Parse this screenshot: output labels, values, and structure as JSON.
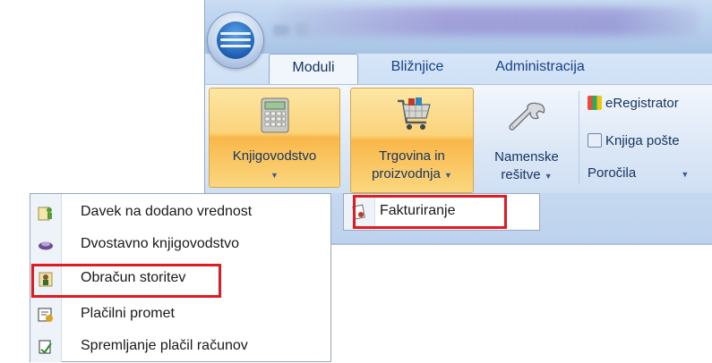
{
  "window": {
    "title": ""
  },
  "tabs": [
    {
      "label": "Moduli",
      "active": true
    },
    {
      "label": "Bližnjice",
      "active": false
    },
    {
      "label": "Administracija",
      "active": false
    }
  ],
  "ribbon": {
    "knjigovodstvo": {
      "label": "Knjigovodstvo",
      "icon": "calculator-icon"
    },
    "trgovina": {
      "line1": "Trgovina in",
      "line2": "proizvodnja",
      "icon": "shopping-cart-icon"
    },
    "namenske": {
      "line1": "Namenske",
      "line2": "rešitve",
      "icon": "wrench-icon"
    },
    "small": [
      {
        "label": "eRegistrator",
        "icon": "books-icon"
      },
      {
        "label": "Knjiga pošte",
        "icon": "mail-book-icon"
      },
      {
        "label": "Poročila",
        "icon": ""
      }
    ]
  },
  "menu_left": {
    "items": [
      {
        "label": "Davek na dodano vrednost",
        "icon": "vat-people-icon"
      },
      {
        "label": "Dvostavno knjigovodstvo",
        "icon": "double-entry-icon"
      },
      {
        "label": "Obračun storitev",
        "icon": "service-person-icon",
        "highlighted": true
      },
      {
        "label": "Plačilni promet",
        "icon": "payment-document-icon"
      },
      {
        "label": "Spremljanje plačil računov",
        "icon": "invoice-tracking-icon"
      }
    ]
  },
  "menu_right": {
    "items": [
      {
        "label": "Fakturiranje",
        "icon": "invoice-icon",
        "highlighted": true
      }
    ]
  },
  "colors": {
    "highlight_box": "#e01b22",
    "hot_button": "#fbd37b",
    "ribbon_text": "#15335f"
  }
}
